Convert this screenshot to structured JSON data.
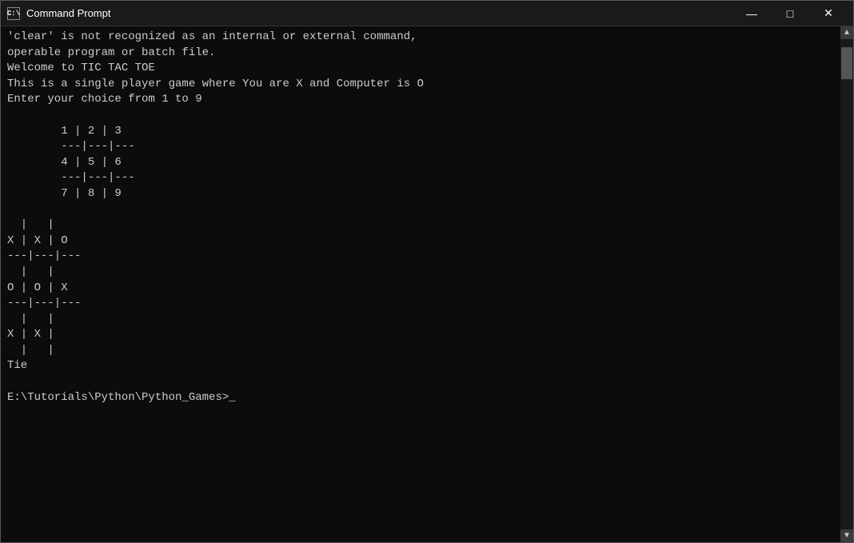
{
  "window": {
    "title": "Command Prompt",
    "icon_label": "C:\\",
    "controls": {
      "minimize": "—",
      "maximize": "□",
      "close": "✕"
    }
  },
  "terminal": {
    "lines": [
      "'clear' is not recognized as an internal or external command,",
      "operable program or batch file.",
      "Welcome to TIC TAC TOE",
      "This is a single player game where You are X and Computer is O",
      "Enter your choice from 1 to 9",
      "",
      "        1 | 2 | 3",
      "        ---|---|---",
      "        4 | 5 | 6",
      "        ---|---|---",
      "        7 | 8 | 9",
      "",
      "  |   |",
      "X | X | O",
      "---|---|---",
      "  |   |",
      "O | O | X",
      "---|---|---",
      "  |   |",
      "X | X |",
      "  |   |",
      "Tie",
      "",
      "E:\\Tutorials\\Python\\Python_Games>_"
    ],
    "prompt": "E:\\Tutorials\\Python\\Python_Games>_"
  }
}
